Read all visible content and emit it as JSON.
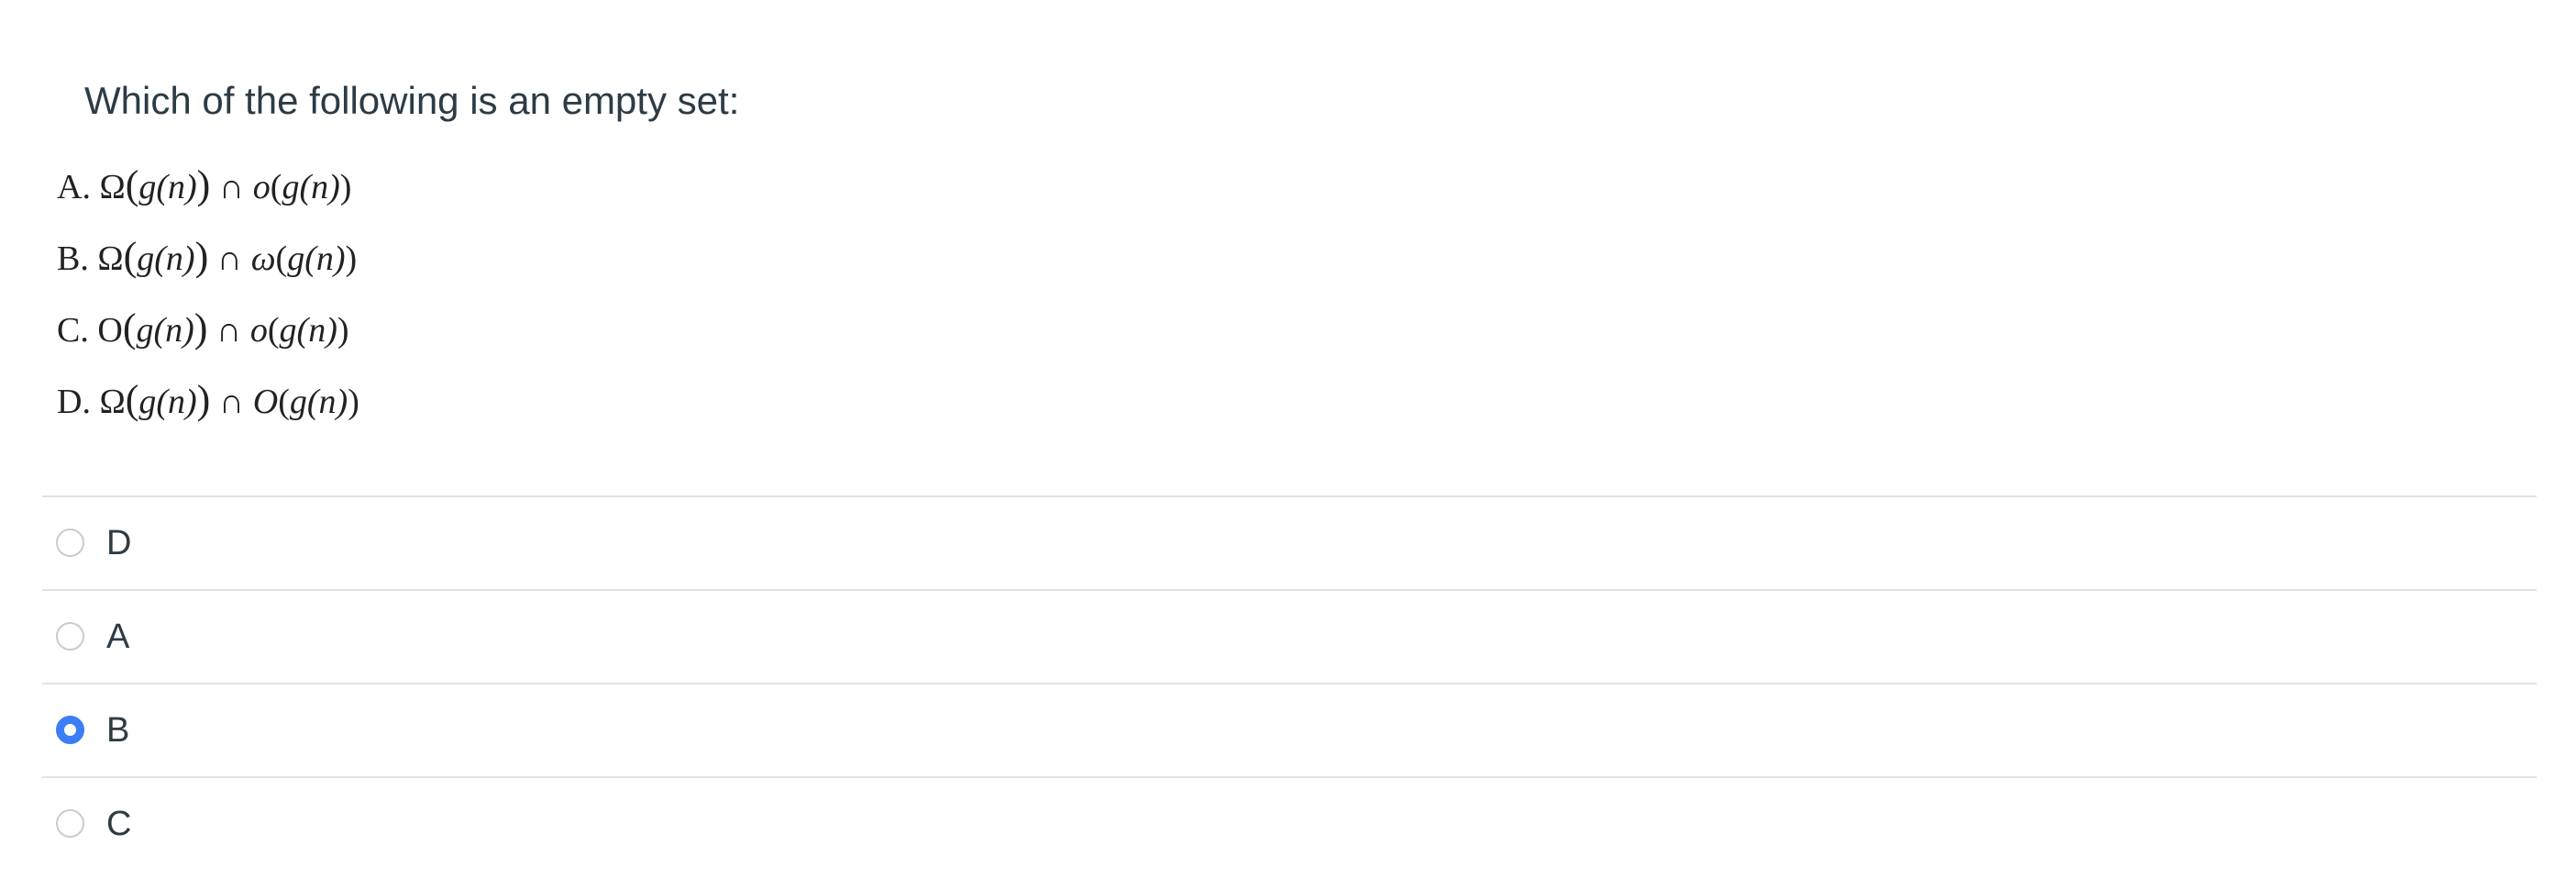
{
  "question": {
    "text": "Which of the following is an empty set:",
    "statements": [
      {
        "label": "A.",
        "f1": "Ω",
        "f2": "o"
      },
      {
        "label": "B.",
        "f1": "Ω",
        "f2": "ω"
      },
      {
        "label": "C.",
        "f1": "O",
        "f2": "o"
      },
      {
        "label": "D.",
        "f1": "Ω",
        "f2": "O"
      }
    ],
    "arg": "g(n)",
    "intersect": "∩"
  },
  "answers": [
    {
      "label": "D",
      "selected": false
    },
    {
      "label": "A",
      "selected": false
    },
    {
      "label": "B",
      "selected": true
    },
    {
      "label": "C",
      "selected": false
    }
  ],
  "colors": {
    "accent": "#3b7ef6",
    "divider": "#dfe3e6",
    "text": "#2d3b45"
  }
}
